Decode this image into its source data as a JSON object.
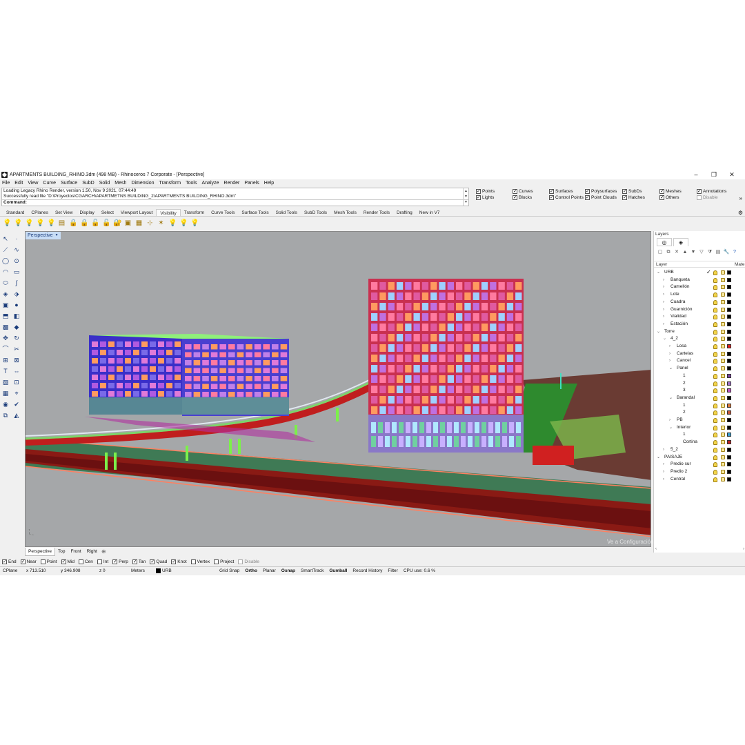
{
  "window": {
    "title": "APARTMENTS BUILDING_RHINO.3dm (498 MB) - Rhinoceros 7 Corporate - [Perspective]",
    "controls": [
      "–",
      "❐",
      "✕"
    ]
  },
  "menu": [
    "File",
    "Edit",
    "View",
    "Curve",
    "Surface",
    "SubD",
    "Solid",
    "Mesh",
    "Dimension",
    "Transform",
    "Tools",
    "Analyze",
    "Render",
    "Panels",
    "Help"
  ],
  "command": {
    "history": [
      "Loading Legacy Rhino Render, version 1.50, Nov  9 2021, 07:44:49",
      "Successfully read file \"D:\\Proyectos\\CGARCH\\APARTMETNS BUILDING_2\\APARTMENTS BUILDING_RHINO.3dm\""
    ],
    "prompt": "Command:",
    "value": ""
  },
  "filters": [
    {
      "label": "Points",
      "checked": true
    },
    {
      "label": "Lights",
      "checked": true
    },
    {
      "label": "Curves",
      "checked": true
    },
    {
      "label": "Blocks",
      "checked": true
    },
    {
      "label": "Surfaces",
      "checked": true
    },
    {
      "label": "Control Points",
      "checked": true
    },
    {
      "label": "Polysurfaces",
      "checked": true
    },
    {
      "label": "Point Clouds",
      "checked": true
    },
    {
      "label": "SubDs",
      "checked": true
    },
    {
      "label": "Hatches",
      "checked": true
    },
    {
      "label": "Meshes",
      "checked": true
    },
    {
      "label": "Others",
      "checked": true
    },
    {
      "label": "Annotations",
      "checked": true
    },
    {
      "label": "Disable",
      "checked": false,
      "disabled": true
    }
  ],
  "toolbar_tabs": [
    "Standard",
    "CPlanes",
    "Set View",
    "Display",
    "Select",
    "Viewport Layout",
    "Visibility",
    "Transform",
    "Curve Tools",
    "Surface Tools",
    "Solid Tools",
    "SubD Tools",
    "Mesh Tools",
    "Render Tools",
    "Drafting",
    "New in V7"
  ],
  "active_toolbar_tab": "Visibility",
  "viewport": {
    "label": "Perspective",
    "background": "#a5a7a9"
  },
  "viewport_tabs": [
    "Perspective",
    "Top",
    "Front",
    "Right"
  ],
  "active_viewport_tab": "Perspective",
  "osnaps": [
    {
      "label": "End",
      "checked": true
    },
    {
      "label": "Near",
      "checked": true
    },
    {
      "label": "Point",
      "checked": false
    },
    {
      "label": "Mid",
      "checked": true
    },
    {
      "label": "Cen",
      "checked": false
    },
    {
      "label": "Int",
      "checked": false
    },
    {
      "label": "Perp",
      "checked": true
    },
    {
      "label": "Tan",
      "checked": true
    },
    {
      "label": "Quad",
      "checked": true
    },
    {
      "label": "Knot",
      "checked": true
    },
    {
      "label": "Vertex",
      "checked": false
    },
    {
      "label": "Project",
      "checked": false
    },
    {
      "label": "Disable",
      "checked": false,
      "disabled": true
    }
  ],
  "status": {
    "cplane": "CPlane",
    "x": "x 713.510",
    "y": "y 346.908",
    "z": "z 0",
    "units": "Meters",
    "layer": "URB",
    "grid_snap": "Grid Snap",
    "ortho": "Ortho",
    "planar": "Planar",
    "osnap": "Osnap",
    "smarttrack": "SmartTrack",
    "gumball": "Gumball",
    "record_history": "Record History",
    "filter": "Filter",
    "cpu": "CPU use: 0.6 %"
  },
  "layers_panel": {
    "title": "Layers",
    "col_layer": "Layer",
    "col_material": "Mate",
    "rows": [
      {
        "name": "URB",
        "depth": 0,
        "expanded": true,
        "current": true,
        "color": "#000000"
      },
      {
        "name": "Banqueta",
        "depth": 1,
        "expanded": false,
        "color": "#000000"
      },
      {
        "name": "Camellón",
        "depth": 1,
        "expanded": false,
        "color": "#000000"
      },
      {
        "name": "Lote",
        "depth": 1,
        "expanded": false,
        "color": "#000000"
      },
      {
        "name": "Cuadra",
        "depth": 1,
        "expanded": false,
        "color": "#000000"
      },
      {
        "name": "Guarnición",
        "depth": 1,
        "expanded": false,
        "color": "#000000"
      },
      {
        "name": "Vialidad",
        "depth": 1,
        "expanded": false,
        "color": "#000000"
      },
      {
        "name": "Estación",
        "depth": 1,
        "expanded": false,
        "color": "#000000"
      },
      {
        "name": "Torre",
        "depth": 0,
        "expanded": true,
        "color": "#000000"
      },
      {
        "name": "4_2",
        "depth": 1,
        "expanded": true,
        "color": "#000000"
      },
      {
        "name": "Losa",
        "depth": 2,
        "expanded": false,
        "color": "#e02020"
      },
      {
        "name": "Cartelas",
        "depth": 2,
        "expanded": false,
        "color": "#000000"
      },
      {
        "name": "Cancel",
        "depth": 2,
        "expanded": false,
        "color": "#000000"
      },
      {
        "name": "Panel",
        "depth": 2,
        "expanded": true,
        "color": "#000000"
      },
      {
        "name": "1",
        "depth": 3,
        "color": "#7a3fa0"
      },
      {
        "name": "2",
        "depth": 3,
        "color": "#a070c8"
      },
      {
        "name": "3",
        "depth": 3,
        "color": "#c050c0"
      },
      {
        "name": "Barandal",
        "depth": 2,
        "expanded": true,
        "color": "#000000"
      },
      {
        "name": "1",
        "depth": 3,
        "color": "#e07a3a"
      },
      {
        "name": "2",
        "depth": 3,
        "color": "#c8583a"
      },
      {
        "name": "PB",
        "depth": 2,
        "expanded": false,
        "color": "#000000"
      },
      {
        "name": "Interior",
        "depth": 2,
        "expanded": true,
        "color": "#000000"
      },
      {
        "name": "1",
        "depth": 3,
        "color": "#3aa0d0"
      },
      {
        "name": "Cortina",
        "depth": 3,
        "color": "#c02020"
      },
      {
        "name": "5_2",
        "depth": 1,
        "expanded": false,
        "color": "#000000"
      },
      {
        "name": "PAISAJE",
        "depth": 0,
        "expanded": true,
        "color": "#000000"
      },
      {
        "name": "Predio sur",
        "depth": 1,
        "expanded": false,
        "color": "#000000"
      },
      {
        "name": "Predio 2",
        "depth": 1,
        "expanded": false,
        "color": "#000000"
      },
      {
        "name": "Central",
        "depth": 1,
        "expanded": false,
        "color": "#000000"
      }
    ]
  },
  "watermark": "Ve a Configuración para activar Windows."
}
